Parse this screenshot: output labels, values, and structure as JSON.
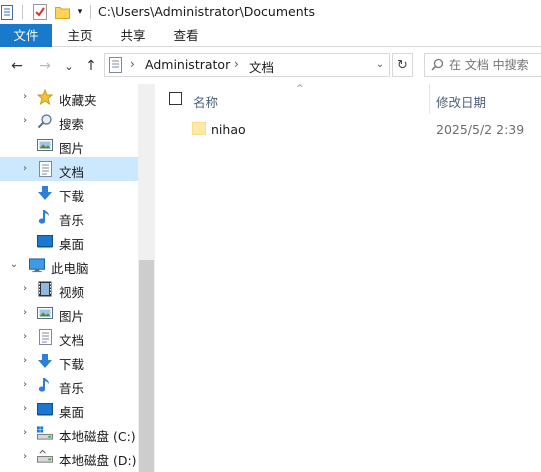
{
  "titlebar": {
    "path": "C:\\Users\\Administrator\\Documents",
    "quick_access": [
      "properties-icon",
      "checkmark-icon",
      "new-folder-icon",
      "customize-dropdown-icon"
    ]
  },
  "ribbon": {
    "tabs": [
      {
        "label": "文件"
      },
      {
        "label": "主页"
      },
      {
        "label": "共享"
      },
      {
        "label": "查看"
      }
    ]
  },
  "nav": {
    "back_icon": "←",
    "forward_icon": "→",
    "recent_icon": "⌄",
    "up_icon": "↑"
  },
  "address": {
    "crumbs": [
      {
        "label": "Administrator"
      },
      {
        "label": "文档"
      }
    ],
    "chevron": "›",
    "dropdown": "⌄",
    "refresh": "↻"
  },
  "search": {
    "placeholder": "在 文档 中搜索"
  },
  "sidebar": {
    "items": [
      {
        "label": "收藏夹",
        "icon": "star-icon",
        "expander": "›"
      },
      {
        "label": "搜索",
        "icon": "search-icon",
        "expander": "›"
      },
      {
        "label": "图片",
        "icon": "pictures-icon",
        "expander": ""
      },
      {
        "label": "文档",
        "icon": "documents-icon",
        "expander": "›",
        "selected": true
      },
      {
        "label": "下载",
        "icon": "download-icon",
        "expander": ""
      },
      {
        "label": "音乐",
        "icon": "music-icon",
        "expander": ""
      },
      {
        "label": "桌面",
        "icon": "desktop-icon",
        "expander": ""
      },
      {
        "label": "此电脑",
        "icon": "computer-icon",
        "expander": "⌄"
      },
      {
        "label": "视频",
        "icon": "video-icon",
        "expander": "›"
      },
      {
        "label": "图片",
        "icon": "pictures-icon",
        "expander": "›"
      },
      {
        "label": "文档",
        "icon": "documents-icon",
        "expander": "›"
      },
      {
        "label": "下载",
        "icon": "download-icon",
        "expander": "›"
      },
      {
        "label": "音乐",
        "icon": "music-icon",
        "expander": "›"
      },
      {
        "label": "桌面",
        "icon": "desktop-icon",
        "expander": "›"
      },
      {
        "label": "本地磁盘 (C:)",
        "icon": "system-drive-icon",
        "expander": "›"
      },
      {
        "label": "本地磁盘 (D:)",
        "icon": "drive-icon",
        "expander": "›"
      }
    ]
  },
  "content": {
    "columns": {
      "name": "名称",
      "modified": "修改日期",
      "sort_indicator": "^"
    },
    "files": [
      {
        "name": "nihao",
        "modified": "2025/5/2 2:39",
        "icon": "folder-icon"
      }
    ]
  },
  "colors": {
    "file_tab": "#1979ca",
    "selection": "#cce8ff",
    "header_text": "#4c607a",
    "folder": "#ffe9a6"
  }
}
